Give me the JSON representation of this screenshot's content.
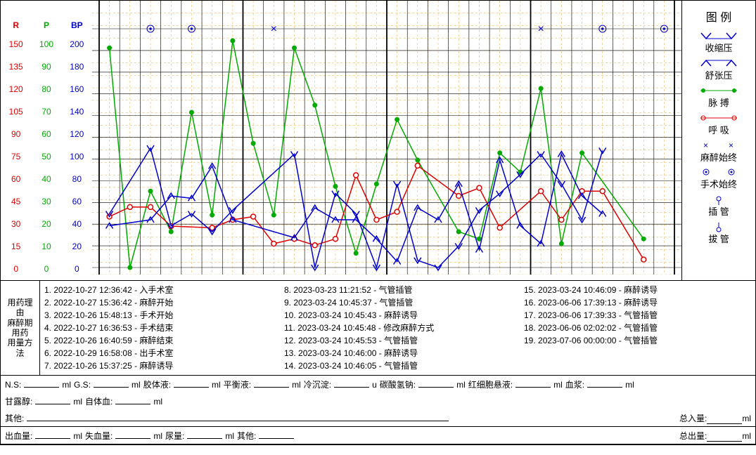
{
  "axes": {
    "R": {
      "label": "R",
      "color": "#d00",
      "ticks": [
        150,
        135,
        120,
        105,
        90,
        75,
        60,
        45,
        30,
        15,
        0
      ]
    },
    "P": {
      "label": "P",
      "color": "#0a0",
      "ticks": [
        100,
        90,
        80,
        70,
        60,
        50,
        40,
        30,
        20,
        10,
        0
      ]
    },
    "BP": {
      "label": "BP",
      "color": "#00c",
      "ticks": [
        200,
        180,
        160,
        140,
        120,
        100,
        80,
        60,
        40,
        20,
        0
      ]
    }
  },
  "legend": {
    "title": "图 例",
    "items": [
      {
        "name": "收缩压",
        "sym": "sbp"
      },
      {
        "name": "舒张压",
        "sym": "dbp"
      },
      {
        "name": "脉 搏",
        "sym": "pulse"
      },
      {
        "name": "呼 吸",
        "sym": "resp"
      },
      {
        "name": "麻醉始终",
        "sym": "anes"
      },
      {
        "name": "手术始终",
        "sym": "surg"
      },
      {
        "name": "插 管",
        "sym": "intub"
      },
      {
        "name": "拔 管",
        "sym": "extub"
      }
    ]
  },
  "events": {
    "side_labels": [
      "用药理由",
      "麻醉期用药",
      "用量方法"
    ],
    "cols": [
      [
        "1. 2022-10-27 12:36:42 - 入手术室",
        "2. 2022-10-27 15:36:42 - 麻醉开始",
        "3. 2022-10-26 15:48:13 - 手术开始",
        "4. 2022-10-27 16:36:53 - 手术结束",
        "5. 2022-10-26 16:40:59 - 麻醉结束",
        "6. 2022-10-29 16:58:08 - 出手术室",
        "7. 2022-10-26 15:37:25 - 麻醉诱导"
      ],
      [
        "8. 2023-03-23 11:21:52 - 气管插管",
        "9. 2023-03-24 10:45:37 - 气管插管",
        "10. 2023-03-24 10:45:43 - 麻醉诱导",
        "11. 2023-03-24 10:45:48 - 修改麻醉方式",
        "12. 2023-03-24 10:45:53 - 气管插管",
        "13. 2023-03-24 10:46:00 - 麻醉诱导",
        "14. 2023-03-24 10:46:05 - 气管插管"
      ],
      [
        "15. 2023-03-24 10:46:09 - 麻醉诱导",
        "16. 2023-06-06 17:39:13 - 麻醉诱导",
        "17. 2023-06-06 17:39:33 - 气管插管",
        "18. 2023-06-06 02:02:02 - 气管插管",
        "19. 2023-07-06 00:00:00 - 气管插管"
      ]
    ]
  },
  "fluids": {
    "line1": [
      {
        "label": "N.S:",
        "unit": "ml"
      },
      {
        "label": "G.S:",
        "unit": "ml"
      },
      {
        "label": "胶体液:",
        "unit": "ml"
      },
      {
        "label": "平衡液:",
        "unit": "ml"
      },
      {
        "label": "冷沉淀:",
        "unit": "u"
      },
      {
        "label": "碳酸氢钠:",
        "unit": "ml"
      },
      {
        "label": "红细胞悬液:",
        "unit": "ml"
      },
      {
        "label": "血浆:",
        "unit": "ml"
      }
    ],
    "line2": [
      {
        "label": "甘露醇:",
        "unit": "ml"
      },
      {
        "label": "自体血:",
        "unit": "ml"
      }
    ],
    "line3": {
      "label": "其他:",
      "total": {
        "label": "总入量:",
        "unit": "ml"
      }
    },
    "line4": {
      "items": [
        {
          "label": "出血量:",
          "unit": "ml"
        },
        {
          "label": "失血量:",
          "unit": "ml"
        },
        {
          "label": "尿量:",
          "unit": "ml"
        },
        {
          "label": "其他:",
          "unit": ""
        }
      ],
      "total": {
        "label": "总出量:",
        "unit": "ml"
      }
    }
  },
  "chart_data": {
    "type": "line",
    "x_count": 28,
    "markers": {
      "surgery": [
        3,
        5,
        25,
        28
      ],
      "anesthesia": [
        9,
        22
      ]
    },
    "series": [
      {
        "name": "脉搏(P)",
        "axis": "P",
        "color": "#0a0",
        "marker": "dot",
        "values": [
          92,
          0,
          32,
          15,
          65,
          22,
          95,
          52,
          22,
          92,
          68,
          34,
          6,
          35,
          62,
          45,
          null,
          15,
          12,
          48,
          40,
          75,
          10,
          48,
          null,
          null,
          12,
          null
        ]
      },
      {
        "name": "呼吸(R)",
        "axis": "R",
        "color": "#d00",
        "marker": "o",
        "values": [
          32,
          38,
          38,
          26,
          null,
          25,
          30,
          32,
          15,
          18,
          14,
          18,
          58,
          30,
          35,
          64,
          null,
          45,
          50,
          25,
          null,
          48,
          30,
          48,
          48,
          null,
          5,
          null
        ]
      },
      {
        "name": "收缩压(BP)",
        "axis": "BP",
        "color": "#00c",
        "marker": "v",
        "values": [
          45,
          null,
          100,
          35,
          45,
          30,
          48,
          null,
          null,
          95,
          0,
          62,
          45,
          0,
          70,
          6,
          0,
          18,
          48,
          62,
          78,
          95,
          70,
          40,
          98,
          null,
          null,
          null
        ]
      },
      {
        "name": "舒张压(BP)",
        "axis": "BP",
        "color": "#00c",
        "marker": "^",
        "values": [
          35,
          null,
          40,
          60,
          58,
          85,
          40,
          null,
          null,
          25,
          50,
          40,
          40,
          24,
          5,
          50,
          40,
          70,
          15,
          90,
          35,
          20,
          95,
          60,
          45,
          null,
          null,
          null
        ]
      }
    ]
  }
}
